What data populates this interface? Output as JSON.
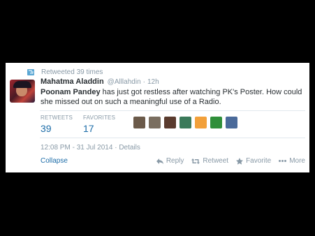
{
  "retweet_context": {
    "text": "Retweeted 39 times"
  },
  "author": {
    "name": "Mahatma Aladdin",
    "handle": "@Alllahdin",
    "time": "12h"
  },
  "tweet": {
    "mention": "Poonam Pandey",
    "text": " has just got restless after watching PK's Poster. How could she missed out on such a meaningful use of a Radio."
  },
  "stats": {
    "retweets_label": "RETWEETS",
    "retweets_value": "39",
    "favorites_label": "FAVORITES",
    "favorites_value": "17"
  },
  "retweeter_avatars": [
    "#6b5a4a",
    "#7a6e60",
    "#5a3b2e",
    "#3b7a5a",
    "#f2a03a",
    "#2f8f3a",
    "#4a6a9a"
  ],
  "meta": {
    "timestamp": "12:08 PM - 31 Jul 2014",
    "separator": "·",
    "details": "Details"
  },
  "collapse_label": "Collapse",
  "actions": {
    "reply": "Reply",
    "retweet": "Retweet",
    "favorite": "Favorite",
    "more": "More"
  },
  "colors": {
    "accent": "#1c6ca8",
    "muted": "#8899a6",
    "text": "#292f33"
  }
}
